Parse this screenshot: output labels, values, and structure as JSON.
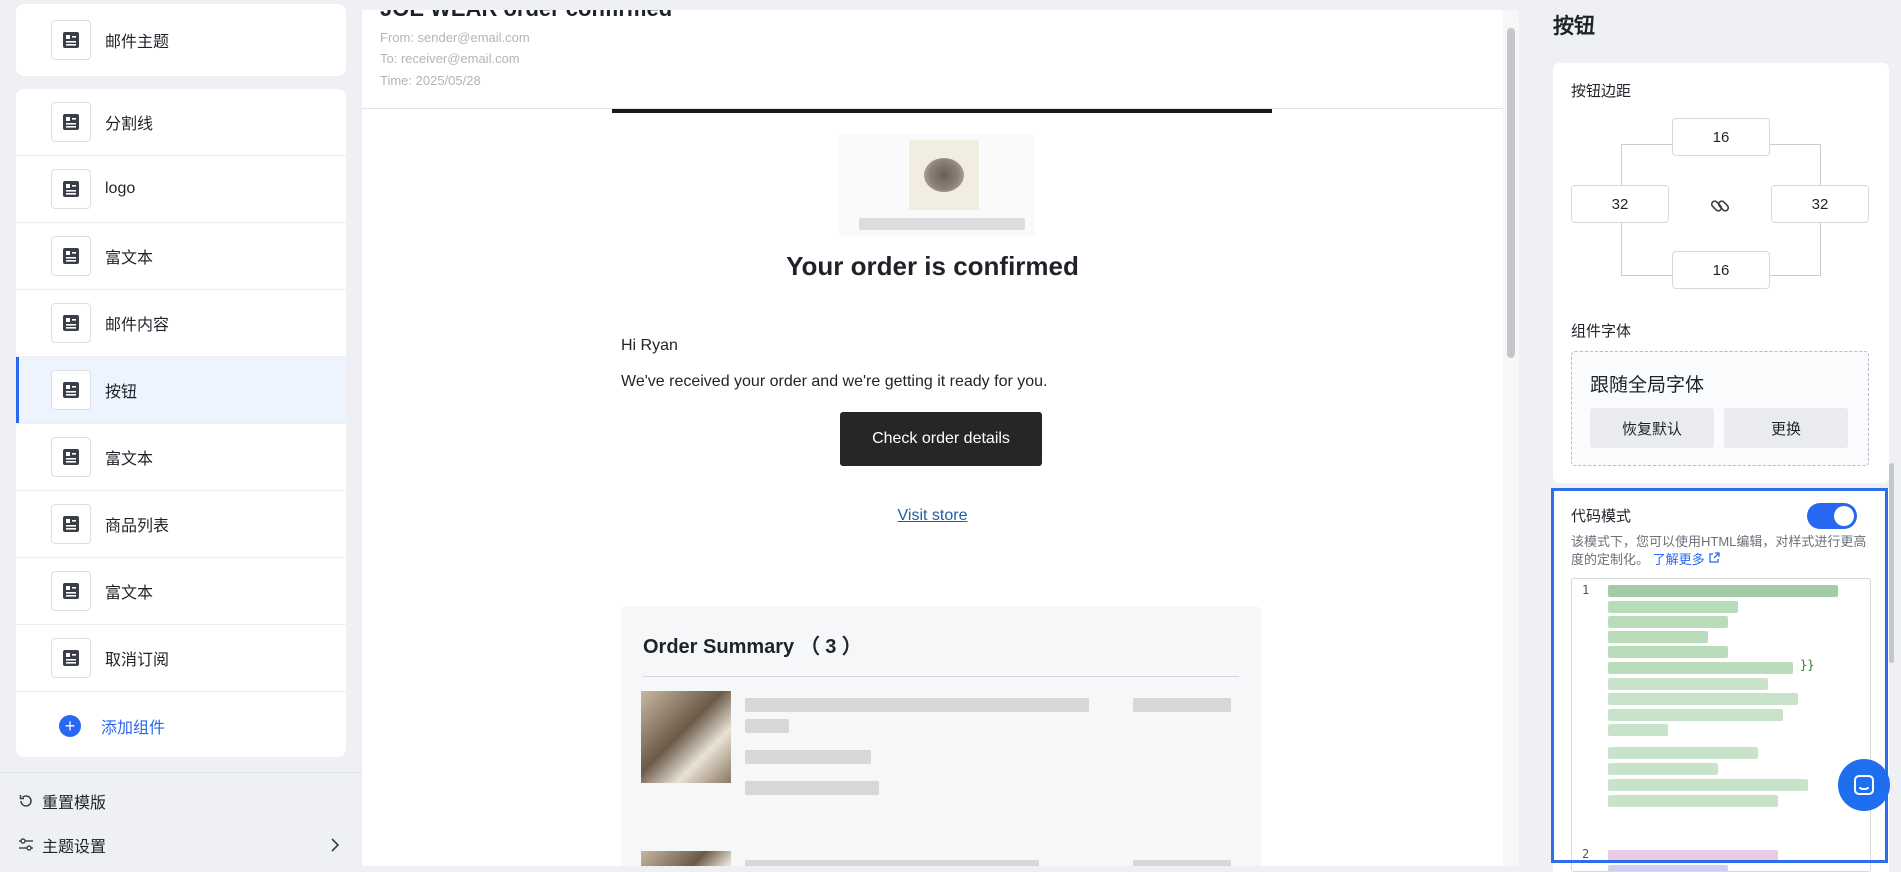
{
  "sidebar": {
    "subject_item": {
      "label": "邮件主题",
      "icon": "layout-icon"
    },
    "items": [
      {
        "label": "分割线",
        "icon": "layout-icon",
        "active": false
      },
      {
        "label": "logo",
        "icon": "layout-icon",
        "active": false
      },
      {
        "label": "富文本",
        "icon": "layout-icon",
        "active": false
      },
      {
        "label": "邮件内容",
        "icon": "layout-icon",
        "active": false
      },
      {
        "label": "按钮",
        "icon": "layout-icon",
        "active": true
      },
      {
        "label": "富文本",
        "icon": "layout-icon",
        "active": false
      },
      {
        "label": "商品列表",
        "icon": "layout-icon",
        "active": false
      },
      {
        "label": "富文本",
        "icon": "layout-icon",
        "active": false
      },
      {
        "label": "取消订阅",
        "icon": "layout-icon",
        "active": false
      }
    ],
    "add_component": "添加组件",
    "reset_template": "重置模版",
    "theme_settings": "主题设置"
  },
  "preview": {
    "subject": "JOE WEAR order confirmed",
    "from": "From: sender@email.com",
    "to": "To: receiver@email.com",
    "time": "Time: 2025/05/28",
    "email_title": "Your order is confirmed",
    "greeting": "Hi Ryan",
    "message": "We've received your order and we're getting it ready for you.",
    "cta_label": "Check order details",
    "visit_link": "Visit store",
    "order_summary_title": "Order Summary （ 3 ）"
  },
  "panel": {
    "title": "按钮",
    "button_padding_label": "按钮边距",
    "padding": {
      "top": "16",
      "left": "32",
      "right": "32",
      "bottom": "16"
    },
    "font_label": "组件字体",
    "font_value": "跟随全局字体",
    "reset_default": "恢复默认",
    "change": "更换",
    "code_mode_label": "代码模式",
    "code_mode_enabled": true,
    "code_mode_desc": "该模式下，您可以使用HTML编辑，对样式进行更高度的定制化。",
    "learn_more": "了解更多",
    "code_line_numbers": [
      "1",
      "2"
    ],
    "code_fragment": "}}"
  },
  "colors": {
    "accent": "#2867f0",
    "cta_background": "#262626",
    "highlight_border": "#2b6ef0"
  }
}
